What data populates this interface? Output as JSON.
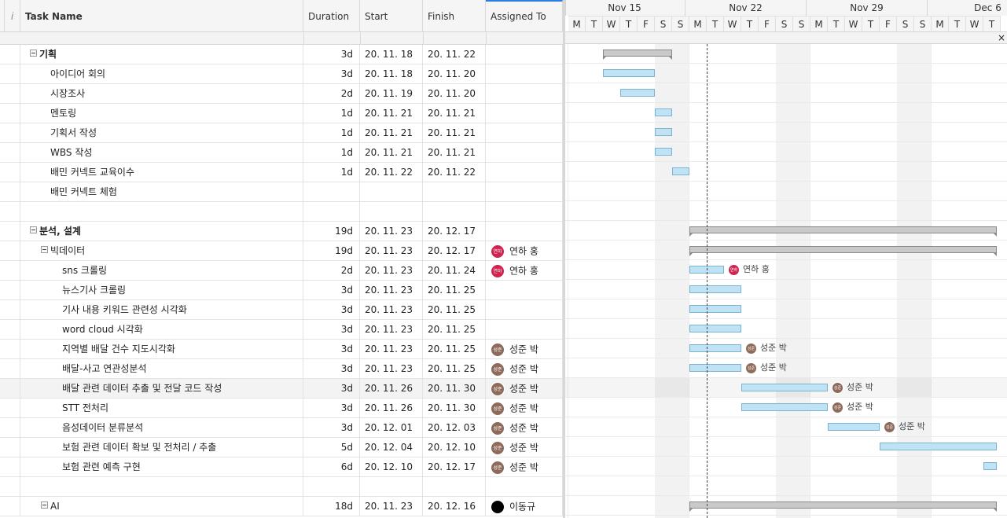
{
  "columns": {
    "info_icon": "i",
    "task_name": "Task Name",
    "duration": "Duration",
    "start": "Start",
    "finish": "Finish",
    "assigned_to": "Assigned To"
  },
  "gantt": {
    "weeks": [
      "Nov 15",
      "Nov 22",
      "Nov 29",
      "Dec 6"
    ],
    "days": [
      "M",
      "T",
      "W",
      "T",
      "F",
      "S",
      "S",
      "M",
      "T",
      "W",
      "T",
      "F",
      "S",
      "S",
      "M",
      "T",
      "W",
      "T",
      "F",
      "S",
      "S",
      "M",
      "T",
      "W",
      "T"
    ],
    "close_label": "×"
  },
  "rows": [
    {
      "name": "기획",
      "level": 0,
      "bold": true,
      "toggle": true,
      "duration": "3d",
      "start": "20. 11. 18",
      "finish": "20. 11. 22",
      "assigned": "",
      "avatar": "",
      "avatar_text": ""
    },
    {
      "name": "아이디어 회의",
      "level": 1,
      "bold": false,
      "toggle": false,
      "duration": "3d",
      "start": "20. 11. 18",
      "finish": "20. 11. 20",
      "assigned": "",
      "avatar": "",
      "avatar_text": ""
    },
    {
      "name": "시장조사",
      "level": 1,
      "bold": false,
      "toggle": false,
      "duration": "2d",
      "start": "20. 11. 19",
      "finish": "20. 11. 20",
      "assigned": "",
      "avatar": "",
      "avatar_text": ""
    },
    {
      "name": "멘토링",
      "level": 1,
      "bold": false,
      "toggle": false,
      "duration": "1d",
      "start": "20. 11. 21",
      "finish": "20. 11. 21",
      "assigned": "",
      "avatar": "",
      "avatar_text": ""
    },
    {
      "name": "기획서 작성",
      "level": 1,
      "bold": false,
      "toggle": false,
      "duration": "1d",
      "start": "20. 11. 21",
      "finish": "20. 11. 21",
      "assigned": "",
      "avatar": "",
      "avatar_text": ""
    },
    {
      "name": "WBS 작성",
      "level": 1,
      "bold": false,
      "toggle": false,
      "duration": "1d",
      "start": "20. 11. 21",
      "finish": "20. 11. 21",
      "assigned": "",
      "avatar": "",
      "avatar_text": ""
    },
    {
      "name": "배민 커넥트 교육이수",
      "level": 1,
      "bold": false,
      "toggle": false,
      "duration": "1d",
      "start": "20. 11. 22",
      "finish": "20. 11. 22",
      "assigned": "",
      "avatar": "",
      "avatar_text": ""
    },
    {
      "name": "배민 커넥트 체험",
      "level": 1,
      "bold": false,
      "toggle": false,
      "duration": "",
      "start": "",
      "finish": "",
      "assigned": "",
      "avatar": "",
      "avatar_text": ""
    },
    {
      "name": "",
      "level": 1,
      "bold": false,
      "toggle": false,
      "duration": "",
      "start": "",
      "finish": "",
      "assigned": "",
      "avatar": "",
      "avatar_text": ""
    },
    {
      "name": "분석, 설계",
      "level": 0,
      "bold": true,
      "toggle": true,
      "duration": "19d",
      "start": "20. 11. 23",
      "finish": "20. 12. 17",
      "assigned": "",
      "avatar": "",
      "avatar_text": ""
    },
    {
      "name": "빅데이터",
      "level": 1,
      "bold": false,
      "toggle": true,
      "duration": "19d",
      "start": "20. 11. 23",
      "finish": "20. 12. 17",
      "assigned": "연하 홍",
      "avatar": "red",
      "avatar_text": "연하"
    },
    {
      "name": "sns 크롤링",
      "level": 2,
      "bold": false,
      "toggle": false,
      "duration": "2d",
      "start": "20. 11. 23",
      "finish": "20. 11. 24",
      "assigned": "연하 홍",
      "avatar": "red",
      "avatar_text": "연하"
    },
    {
      "name": "뉴스기사 크롤링",
      "level": 2,
      "bold": false,
      "toggle": false,
      "duration": "3d",
      "start": "20. 11. 23",
      "finish": "20. 11. 25",
      "assigned": "",
      "avatar": "",
      "avatar_text": ""
    },
    {
      "name": "기사 내용 키워드 관련성 시각화",
      "level": 2,
      "bold": false,
      "toggle": false,
      "duration": "3d",
      "start": "20. 11. 23",
      "finish": "20. 11. 25",
      "assigned": "",
      "avatar": "",
      "avatar_text": ""
    },
    {
      "name": "word cloud 시각화",
      "level": 2,
      "bold": false,
      "toggle": false,
      "duration": "3d",
      "start": "20. 11. 23",
      "finish": "20. 11. 25",
      "assigned": "",
      "avatar": "",
      "avatar_text": ""
    },
    {
      "name": "지역별 배달 건수 지도시각화",
      "level": 2,
      "bold": false,
      "toggle": false,
      "duration": "3d",
      "start": "20. 11. 23",
      "finish": "20. 11. 25",
      "assigned": "성준 박",
      "avatar": "brown",
      "avatar_text": "성준"
    },
    {
      "name": "배달-사고 연관성분석",
      "level": 2,
      "bold": false,
      "toggle": false,
      "duration": "3d",
      "start": "20. 11. 23",
      "finish": "20. 11. 25",
      "assigned": "성준 박",
      "avatar": "brown",
      "avatar_text": "성준"
    },
    {
      "name": "배달 관련 데이터 추출 및 전달 코드 작성",
      "level": 2,
      "bold": false,
      "toggle": false,
      "duration": "3d",
      "start": "20. 11. 26",
      "finish": "20. 11. 30",
      "assigned": "성준 박",
      "avatar": "brown",
      "avatar_text": "성준",
      "highlight": true
    },
    {
      "name": "STT 전처리",
      "level": 2,
      "bold": false,
      "toggle": false,
      "duration": "3d",
      "start": "20. 11. 26",
      "finish": "20. 11. 30",
      "assigned": "성준 박",
      "avatar": "brown",
      "avatar_text": "성준"
    },
    {
      "name": "음성데이터 분류분석",
      "level": 2,
      "bold": false,
      "toggle": false,
      "duration": "3d",
      "start": "20. 12. 01",
      "finish": "20. 12. 03",
      "assigned": "성준 박",
      "avatar": "brown",
      "avatar_text": "성준"
    },
    {
      "name": "보험 관련 데이터 확보 및 전처리 / 추출",
      "level": 2,
      "bold": false,
      "toggle": false,
      "duration": "5d",
      "start": "20. 12. 04",
      "finish": "20. 12. 10",
      "assigned": "성준 박",
      "avatar": "brown",
      "avatar_text": "성준"
    },
    {
      "name": "보험 관련 예측 구현",
      "level": 2,
      "bold": false,
      "toggle": false,
      "duration": "6d",
      "start": "20. 12. 10",
      "finish": "20. 12. 17",
      "assigned": "성준 박",
      "avatar": "brown",
      "avatar_text": "성준"
    },
    {
      "name": "",
      "level": 2,
      "bold": false,
      "toggle": false,
      "duration": "",
      "start": "",
      "finish": "",
      "assigned": "",
      "avatar": "",
      "avatar_text": ""
    },
    {
      "name": "AI",
      "level": 1,
      "bold": false,
      "toggle": true,
      "duration": "18d",
      "start": "20. 11. 23",
      "finish": "20. 12. 16",
      "assigned": "이동규",
      "avatar": "black",
      "avatar_text": ""
    }
  ],
  "bars": [
    {
      "row": 0,
      "type": "summary",
      "start": 2,
      "end": 6,
      "label": "",
      "avatar": "",
      "avatar_text": ""
    },
    {
      "row": 1,
      "type": "task",
      "start": 2,
      "end": 5,
      "label": "",
      "avatar": "",
      "avatar_text": ""
    },
    {
      "row": 2,
      "type": "task",
      "start": 3,
      "end": 5,
      "label": "",
      "avatar": "",
      "avatar_text": ""
    },
    {
      "row": 3,
      "type": "task",
      "start": 5,
      "end": 6,
      "label": "",
      "avatar": "",
      "avatar_text": ""
    },
    {
      "row": 4,
      "type": "task",
      "start": 5,
      "end": 6,
      "label": "",
      "avatar": "",
      "avatar_text": ""
    },
    {
      "row": 5,
      "type": "task",
      "start": 5,
      "end": 6,
      "label": "",
      "avatar": "",
      "avatar_text": ""
    },
    {
      "row": 6,
      "type": "task",
      "start": 6,
      "end": 7,
      "label": "",
      "avatar": "",
      "avatar_text": ""
    },
    {
      "row": 9,
      "type": "summary",
      "start": 7,
      "end": 26,
      "label": "",
      "avatar": "",
      "avatar_text": ""
    },
    {
      "row": 10,
      "type": "summary",
      "start": 7,
      "end": 26,
      "label": "",
      "avatar": "",
      "avatar_text": ""
    },
    {
      "row": 11,
      "type": "task",
      "start": 7,
      "end": 9,
      "label": "연하 홍",
      "avatar": "red",
      "avatar_text": "연하"
    },
    {
      "row": 12,
      "type": "task",
      "start": 7,
      "end": 10,
      "label": "",
      "avatar": "",
      "avatar_text": ""
    },
    {
      "row": 13,
      "type": "task",
      "start": 7,
      "end": 10,
      "label": "",
      "avatar": "",
      "avatar_text": ""
    },
    {
      "row": 14,
      "type": "task",
      "start": 7,
      "end": 10,
      "label": "",
      "avatar": "",
      "avatar_text": ""
    },
    {
      "row": 15,
      "type": "task",
      "start": 7,
      "end": 10,
      "label": "성준 박",
      "avatar": "brown",
      "avatar_text": "성준"
    },
    {
      "row": 16,
      "type": "task",
      "start": 7,
      "end": 10,
      "label": "성준 박",
      "avatar": "brown",
      "avatar_text": "성준"
    },
    {
      "row": 17,
      "type": "task",
      "start": 10,
      "end": 15,
      "label": "성준 박",
      "avatar": "brown",
      "avatar_text": "성준"
    },
    {
      "row": 18,
      "type": "task",
      "start": 10,
      "end": 15,
      "label": "성준 박",
      "avatar": "brown",
      "avatar_text": "성준"
    },
    {
      "row": 19,
      "type": "task",
      "start": 15,
      "end": 18,
      "label": "성준 박",
      "avatar": "brown",
      "avatar_text": "성준"
    },
    {
      "row": 20,
      "type": "task",
      "start": 18,
      "end": 26,
      "label": "",
      "avatar": "",
      "avatar_text": ""
    },
    {
      "row": 21,
      "type": "task",
      "start": 24,
      "end": 26,
      "label": "",
      "avatar": "",
      "avatar_text": ""
    },
    {
      "row": 23,
      "type": "summary",
      "start": 7,
      "end": 26,
      "label": "",
      "avatar": "",
      "avatar_text": ""
    }
  ]
}
